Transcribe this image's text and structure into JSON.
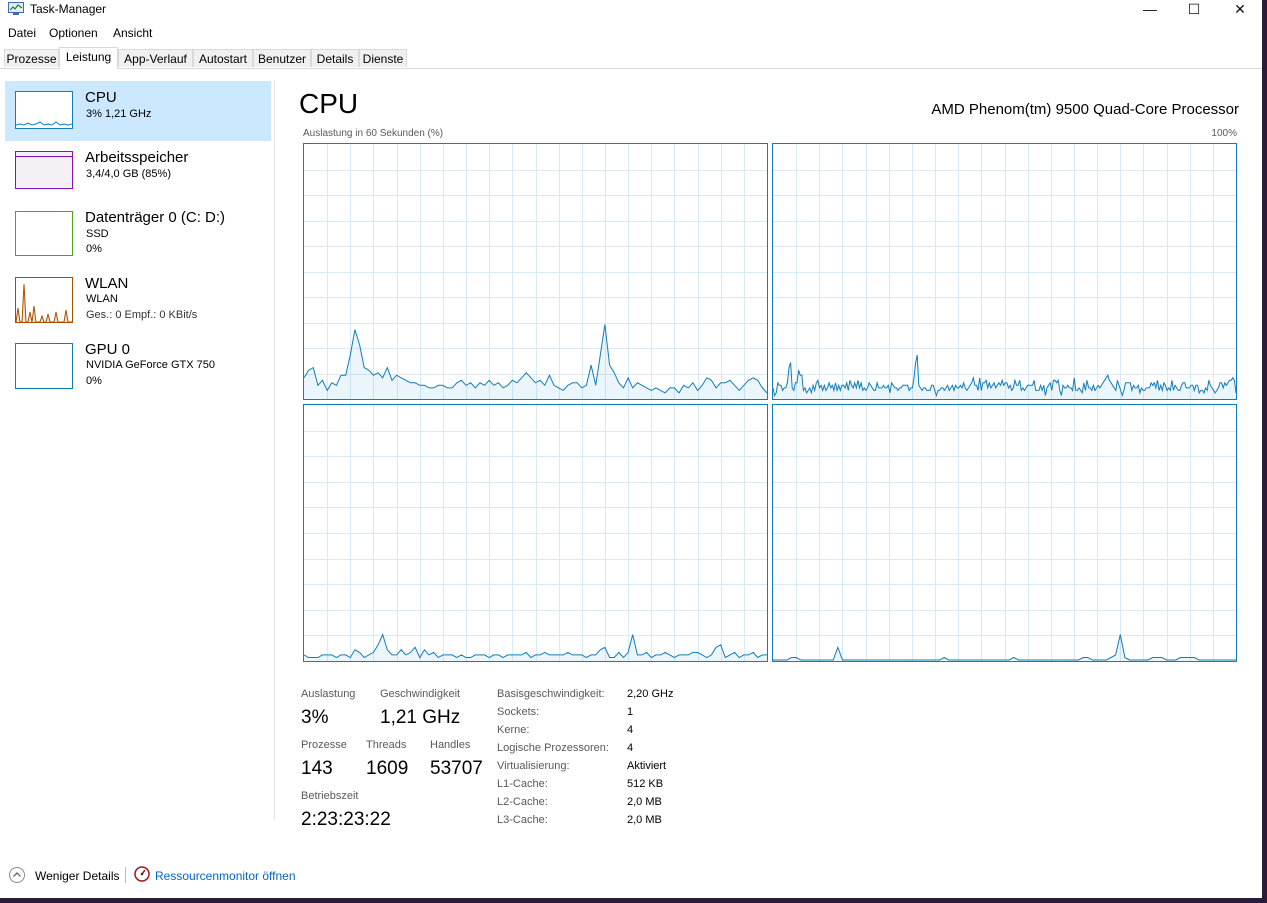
{
  "window": {
    "title": "Task-Manager",
    "buttons": {
      "minimize": "—",
      "maximize": "☐",
      "close": "✕"
    }
  },
  "menu": [
    "Datei",
    "Optionen",
    "Ansicht"
  ],
  "tabs": [
    "Prozesse",
    "Leistung",
    "App-Verlauf",
    "Autostart",
    "Benutzer",
    "Details",
    "Dienste"
  ],
  "active_tab": "Leistung",
  "sidebar": [
    {
      "title": "CPU",
      "sub1": "3%  1,21 GHz",
      "sub2": "",
      "color": "#117dbb",
      "selected": true
    },
    {
      "title": "Arbeitsspeicher",
      "sub1": "3,4/4,0 GB (85%)",
      "sub2": "",
      "color": "#8b12ae"
    },
    {
      "title": "Datenträger 0 (C: D:)",
      "sub1": "SSD",
      "sub2": "0%",
      "color": "#4da60c"
    },
    {
      "title": "WLAN",
      "sub1": "WLAN",
      "sub2": "Ges.: 0 Empf.: 0 KBit/s",
      "color": "#a74f01"
    },
    {
      "title": "GPU 0",
      "sub1": "NVIDIA GeForce GTX 750",
      "sub2": "0%",
      "color": "#117dbb"
    }
  ],
  "main": {
    "title": "CPU",
    "model": "AMD Phenom(tm) 9500 Quad-Core Processor",
    "graph_label": "Auslastung in 60 Sekunden (%)",
    "graph_max": "100%"
  },
  "core_graphs": [
    [
      8,
      11,
      12,
      5,
      7,
      3,
      6,
      5,
      9,
      9,
      17,
      27,
      21,
      12,
      11,
      9,
      10,
      8,
      12,
      7,
      9,
      8,
      7,
      6,
      6,
      5,
      5,
      4,
      4,
      5,
      5,
      4,
      4,
      6,
      7,
      5,
      6,
      4,
      6,
      5,
      7,
      5,
      6,
      4,
      5,
      7,
      6,
      8,
      10,
      8,
      6,
      7,
      5,
      9,
      5,
      4,
      3,
      5,
      6,
      6,
      4,
      5,
      13,
      5,
      17,
      29,
      13,
      10,
      6,
      4,
      8,
      4,
      6,
      5,
      4,
      3,
      4,
      3,
      2,
      4,
      4,
      2,
      5,
      4,
      6,
      3,
      5,
      8,
      7,
      4,
      6,
      6,
      7,
      5,
      3,
      5,
      7,
      8,
      7,
      4,
      2
    ],
    [
      4,
      1,
      2,
      6,
      5,
      5,
      3,
      4,
      4,
      6,
      12,
      14,
      4,
      3,
      6,
      6,
      11,
      9,
      9,
      3,
      4,
      2,
      3,
      4,
      2,
      5,
      3,
      6,
      7,
      4,
      5,
      3,
      5,
      3,
      4,
      6,
      4,
      5,
      3,
      6,
      3,
      5,
      3,
      5,
      5,
      4,
      6,
      3,
      7,
      5,
      4,
      6,
      4,
      7,
      4,
      6,
      3,
      4,
      3,
      4,
      6,
      5,
      4,
      3,
      3,
      6,
      4,
      4,
      4,
      5,
      4,
      4,
      5,
      2,
      6,
      5,
      4,
      4,
      3,
      4,
      4,
      5,
      5,
      5,
      5,
      3,
      4,
      4,
      8,
      14,
      17,
      5,
      4,
      3,
      4,
      4,
      3,
      3,
      3,
      5,
      5,
      3,
      1,
      3,
      3,
      4,
      4,
      3,
      4,
      5,
      3,
      4,
      5,
      3,
      5,
      4,
      4,
      5,
      4,
      6,
      4,
      3,
      4,
      5,
      6,
      8,
      5,
      5,
      3,
      8,
      3,
      6,
      6,
      7,
      4,
      6,
      4,
      5,
      6,
      4,
      5,
      6,
      5,
      7,
      5,
      6,
      6,
      4,
      5,
      3,
      4,
      7,
      5,
      5,
      7,
      3,
      4,
      3,
      4,
      5,
      5,
      5,
      5,
      7,
      3,
      3,
      3,
      5,
      3,
      5,
      1,
      4,
      5,
      6,
      3,
      7,
      7,
      6,
      7,
      3,
      1,
      5,
      4,
      4,
      5,
      4,
      4,
      3,
      8,
      3,
      3,
      4,
      3,
      2,
      6,
      3,
      7,
      4,
      4,
      3,
      5,
      3,
      4,
      5,
      4,
      5,
      6,
      7,
      8,
      9,
      7,
      6,
      5,
      4,
      3,
      7,
      5,
      3,
      1,
      3,
      6,
      6,
      6,
      6,
      3,
      5,
      4,
      4,
      5,
      2,
      4,
      3,
      3,
      4,
      4,
      4,
      6,
      5,
      6,
      4,
      7,
      3,
      5,
      3,
      6,
      5,
      3,
      4,
      3,
      7,
      3,
      5,
      4,
      3,
      3,
      5,
      6,
      6,
      4,
      4,
      4,
      5,
      5,
      3,
      5,
      5,
      2,
      3,
      3,
      2,
      4,
      3,
      7,
      5,
      4,
      3,
      2,
      3,
      4,
      6,
      6,
      4,
      6,
      5,
      6,
      7,
      7,
      8,
      7,
      2
    ],
    [
      2,
      1,
      1,
      1,
      2,
      2,
      2,
      1,
      2,
      2,
      1,
      4,
      3,
      1,
      2,
      3,
      6,
      10,
      4,
      2,
      2,
      4,
      2,
      3,
      5,
      1,
      4,
      2,
      3,
      1,
      2,
      2,
      2,
      1,
      2,
      1,
      1,
      2,
      2,
      2,
      1,
      2,
      2,
      1,
      2,
      2,
      2,
      2,
      3,
      1,
      2,
      2,
      3,
      2,
      2,
      2,
      2,
      3,
      2,
      2,
      2,
      1,
      2,
      2,
      4,
      5,
      1,
      1,
      3,
      1,
      3,
      10,
      2,
      2,
      3,
      1,
      2,
      2,
      3,
      2,
      1,
      2,
      2,
      2,
      3,
      3,
      2,
      1,
      2,
      5,
      6,
      1,
      2,
      3,
      1,
      2,
      2,
      3,
      1,
      2,
      2
    ],
    [
      0,
      0,
      0,
      0,
      1,
      1,
      0,
      0,
      0,
      0,
      0,
      0,
      0,
      0,
      5,
      0,
      0,
      0,
      0,
      0,
      0,
      0,
      0,
      0,
      0,
      0,
      0,
      0,
      0,
      0,
      0,
      0,
      0,
      0,
      0,
      0,
      0,
      1,
      0,
      0,
      0,
      0,
      0,
      0,
      0,
      0,
      0,
      0,
      0,
      0,
      0,
      0,
      1,
      0,
      0,
      0,
      0,
      0,
      0,
      0,
      0,
      0,
      0,
      0,
      0,
      0,
      0,
      1,
      1,
      0,
      0,
      0,
      0,
      1,
      2,
      10,
      1,
      0,
      0,
      0,
      0,
      0,
      1,
      1,
      1,
      0,
      0,
      0,
      1,
      1,
      1,
      1,
      0,
      0,
      0,
      0,
      0,
      0,
      0,
      0,
      0
    ]
  ],
  "stats": {
    "auslastung_label": "Auslastung",
    "auslastung": "3%",
    "geschwindigkeit_label": "Geschwindigkeit",
    "geschwindigkeit": "1,21 GHz",
    "prozesse_label": "Prozesse",
    "prozesse": "143",
    "threads_label": "Threads",
    "threads": "1609",
    "handles_label": "Handles",
    "handles": "53707",
    "betriebszeit_label": "Betriebszeit",
    "betriebszeit": "2:23:23:22"
  },
  "info": [
    {
      "label": "Basisgeschwindigkeit:",
      "value": "2,20 GHz"
    },
    {
      "label": "Sockets:",
      "value": "1"
    },
    {
      "label": "Kerne:",
      "value": "4"
    },
    {
      "label": "Logische Prozessoren:",
      "value": "4"
    },
    {
      "label": "Virtualisierung:",
      "value": "Aktiviert"
    },
    {
      "label": "L1-Cache:",
      "value": "512 KB"
    },
    {
      "label": "L2-Cache:",
      "value": "2,0 MB"
    },
    {
      "label": "L3-Cache:",
      "value": "2,0 MB"
    }
  ],
  "footer": {
    "less_details": "Weniger Details",
    "resource_monitor": "Ressourcenmonitor öffnen"
  }
}
